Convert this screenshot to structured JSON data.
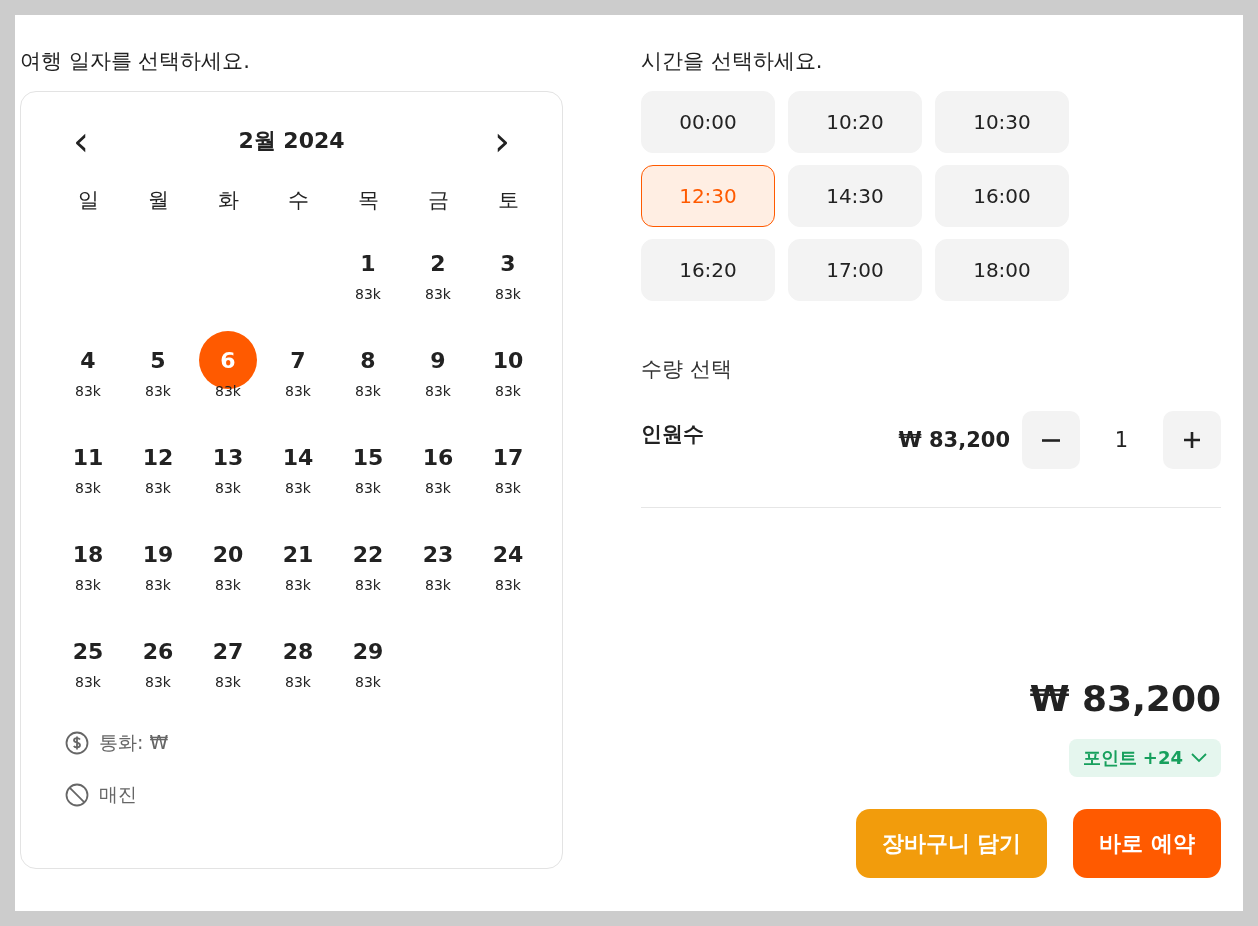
{
  "calendar": {
    "prompt": "여행 일자를 선택하세요.",
    "prev": "‹",
    "month": "2월 2024",
    "next": "›",
    "weekdays": [
      "일",
      "월",
      "화",
      "수",
      "목",
      "금",
      "토"
    ],
    "weeks": [
      [
        {
          "day": "1",
          "price": "83k",
          "selected": false
        },
        {
          "day": "2",
          "price": "83k",
          "selected": false
        },
        {
          "day": "3",
          "price": "83k",
          "selected": false
        }
      ],
      [
        {
          "day": "4",
          "price": "83k",
          "selected": false
        },
        {
          "day": "5",
          "price": "83k",
          "selected": false
        },
        {
          "day": "6",
          "price": "83k",
          "selected": true
        },
        {
          "day": "7",
          "price": "83k",
          "selected": false
        },
        {
          "day": "8",
          "price": "83k",
          "selected": false
        },
        {
          "day": "9",
          "price": "83k",
          "selected": false
        },
        {
          "day": "10",
          "price": "83k",
          "selected": false
        }
      ],
      [
        {
          "day": "11",
          "price": "83k",
          "selected": false
        },
        {
          "day": "12",
          "price": "83k",
          "selected": false
        },
        {
          "day": "13",
          "price": "83k",
          "selected": false
        },
        {
          "day": "14",
          "price": "83k",
          "selected": false
        },
        {
          "day": "15",
          "price": "83k",
          "selected": false
        },
        {
          "day": "16",
          "price": "83k",
          "selected": false
        },
        {
          "day": "17",
          "price": "83k",
          "selected": false
        }
      ],
      [
        {
          "day": "18",
          "price": "83k",
          "selected": false
        },
        {
          "day": "19",
          "price": "83k",
          "selected": false
        },
        {
          "day": "20",
          "price": "83k",
          "selected": false
        },
        {
          "day": "21",
          "price": "83k",
          "selected": false
        },
        {
          "day": "22",
          "price": "83k",
          "selected": false
        },
        {
          "day": "23",
          "price": "83k",
          "selected": false
        },
        {
          "day": "24",
          "price": "83k",
          "selected": false
        }
      ],
      [
        {
          "day": "25",
          "price": "83k",
          "selected": false
        },
        {
          "day": "26",
          "price": "83k",
          "selected": false
        },
        {
          "day": "27",
          "price": "83k",
          "selected": false
        },
        {
          "day": "28",
          "price": "83k",
          "selected": false
        },
        {
          "day": "29",
          "price": "83k",
          "selected": false
        }
      ]
    ],
    "legend": [
      {
        "kind": "currency",
        "label": "통화: ₩"
      },
      {
        "kind": "soldout",
        "label": "매진"
      }
    ]
  },
  "times": {
    "prompt": "시간을 선택하세요.",
    "slots": [
      {
        "label": "00:00",
        "selected": false
      },
      {
        "label": "10:20",
        "selected": false
      },
      {
        "label": "10:30",
        "selected": false
      },
      {
        "label": "12:30",
        "selected": true
      },
      {
        "label": "14:30",
        "selected": false
      },
      {
        "label": "16:00",
        "selected": false
      },
      {
        "label": "16:20",
        "selected": false
      },
      {
        "label": "17:00",
        "selected": false
      },
      {
        "label": "18:00",
        "selected": false
      }
    ]
  },
  "quantity": {
    "title": "수량 선택",
    "label": "인원수",
    "price": "₩ 83,200",
    "count": "1"
  },
  "total": {
    "amount": "₩ 83,200",
    "points": "포인트 +24"
  },
  "buttons": [
    {
      "kind": "cart",
      "label": "장바구니 담기"
    },
    {
      "kind": "book",
      "label": "바로 예약"
    }
  ]
}
